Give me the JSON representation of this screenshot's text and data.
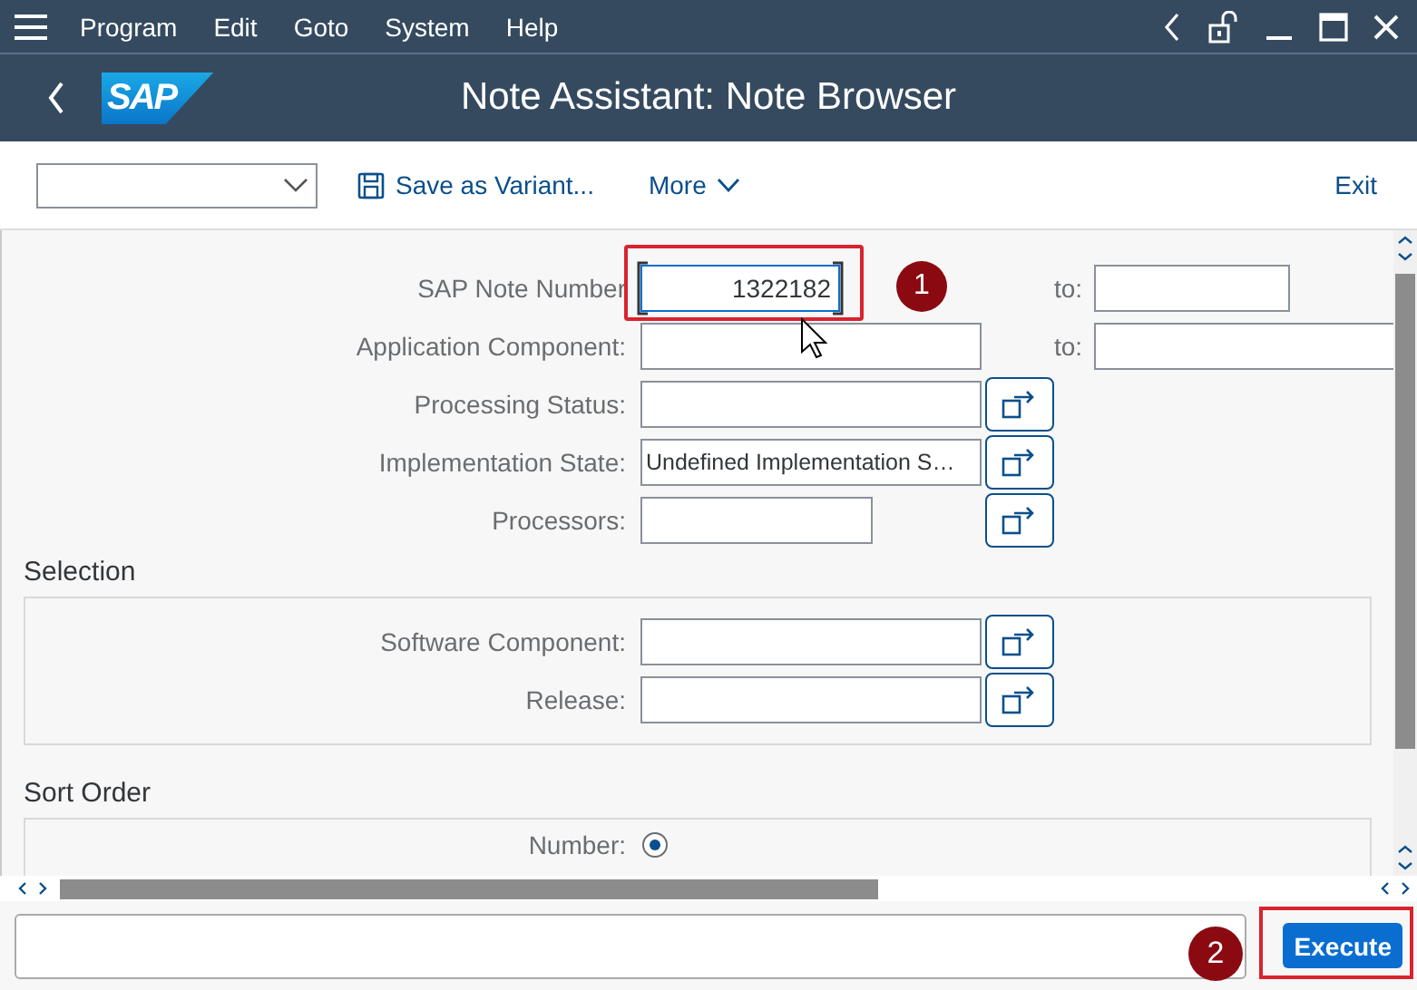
{
  "menu_bar": {
    "items": [
      {
        "label": "Program"
      },
      {
        "label": "Edit"
      },
      {
        "label": "Goto"
      },
      {
        "label": "System"
      },
      {
        "label": "Help"
      }
    ]
  },
  "title_bar": {
    "logo": "SAP",
    "title": "Note Assistant: Note Browser"
  },
  "toolbar": {
    "buttons": [
      {
        "kind": "save",
        "label": "Save as Variant..."
      },
      {
        "kind": "more",
        "label": "More"
      }
    ],
    "exit": "Exit"
  },
  "fields": [
    {
      "label": "SAP Note Number",
      "value": "1322182",
      "kind": "range",
      "focused": true,
      "to_label": "to:"
    },
    {
      "label": "Application Component:",
      "kind": "range",
      "focused": false,
      "to_label": "to:"
    },
    {
      "label": "Processing Status:",
      "kind": "help",
      "focused": false
    },
    {
      "label": "Implementation State:",
      "value": "Undefined Implementation S…",
      "kind": "help",
      "focused": false
    },
    {
      "label": "Processors:",
      "kind": "help",
      "focused": false
    }
  ],
  "sections": [
    {
      "title": "Selection",
      "kind": "fields",
      "fields": [
        {
          "label": "Software Component:"
        },
        {
          "label": "Release:"
        }
      ]
    },
    {
      "title": "Sort Order",
      "kind": "radios",
      "options": [
        {
          "label": "Number:",
          "selected": true
        }
      ]
    }
  ],
  "footer": {
    "execute": "Execute"
  },
  "callouts": [
    {
      "label": "1"
    },
    {
      "label": "2"
    }
  ]
}
